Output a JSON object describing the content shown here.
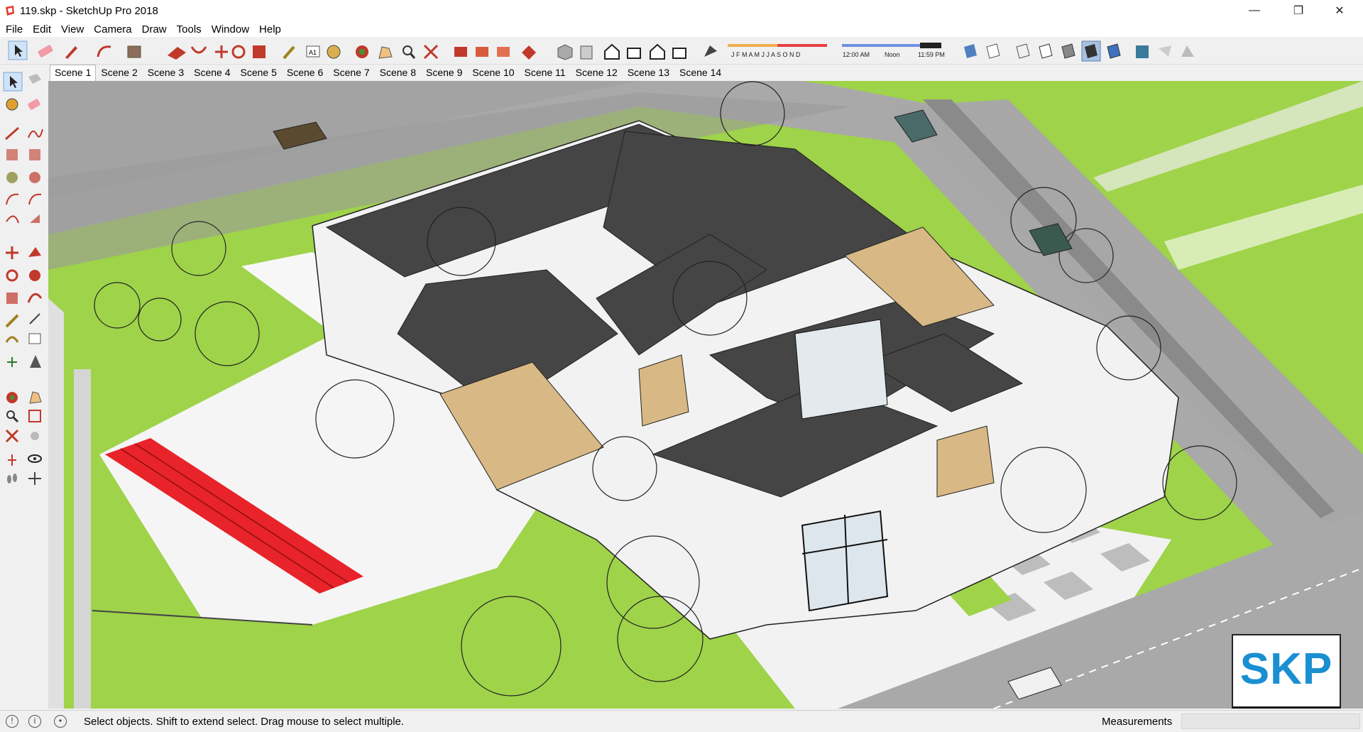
{
  "window": {
    "title": "119.skp - SketchUp Pro 2018",
    "minimize": "—",
    "restore": "❐",
    "close": "✕"
  },
  "menu": [
    "File",
    "Edit",
    "View",
    "Camera",
    "Draw",
    "Tools",
    "Window",
    "Help"
  ],
  "shadow_toolbar": {
    "months": "J F M A M J J A S O N D",
    "time_start": "12:00 AM",
    "time_mid": "Noon",
    "time_end": "11:59 PM"
  },
  "scenes": [
    "Scene 1",
    "Scene 2",
    "Scene 3",
    "Scene 4",
    "Scene 5",
    "Scene 6",
    "Scene 7",
    "Scene 8",
    "Scene 9",
    "Scene 10",
    "Scene 11",
    "Scene 12",
    "Scene 13",
    "Scene 14"
  ],
  "active_scene": "Scene 1",
  "status": {
    "message": "Select objects. Shift to extend select. Drag mouse to select multiple.",
    "measurements_label": "Measurements",
    "measurements_value": ""
  },
  "watermark": "SKP",
  "colors": {
    "grass": "#9fd34a",
    "roof": "#454545",
    "wall": "#f2f2f2",
    "wood": "#d8b884",
    "track": "#e8232a",
    "road": "#a6a6a6",
    "badge_blue": "#1a8fd1"
  }
}
